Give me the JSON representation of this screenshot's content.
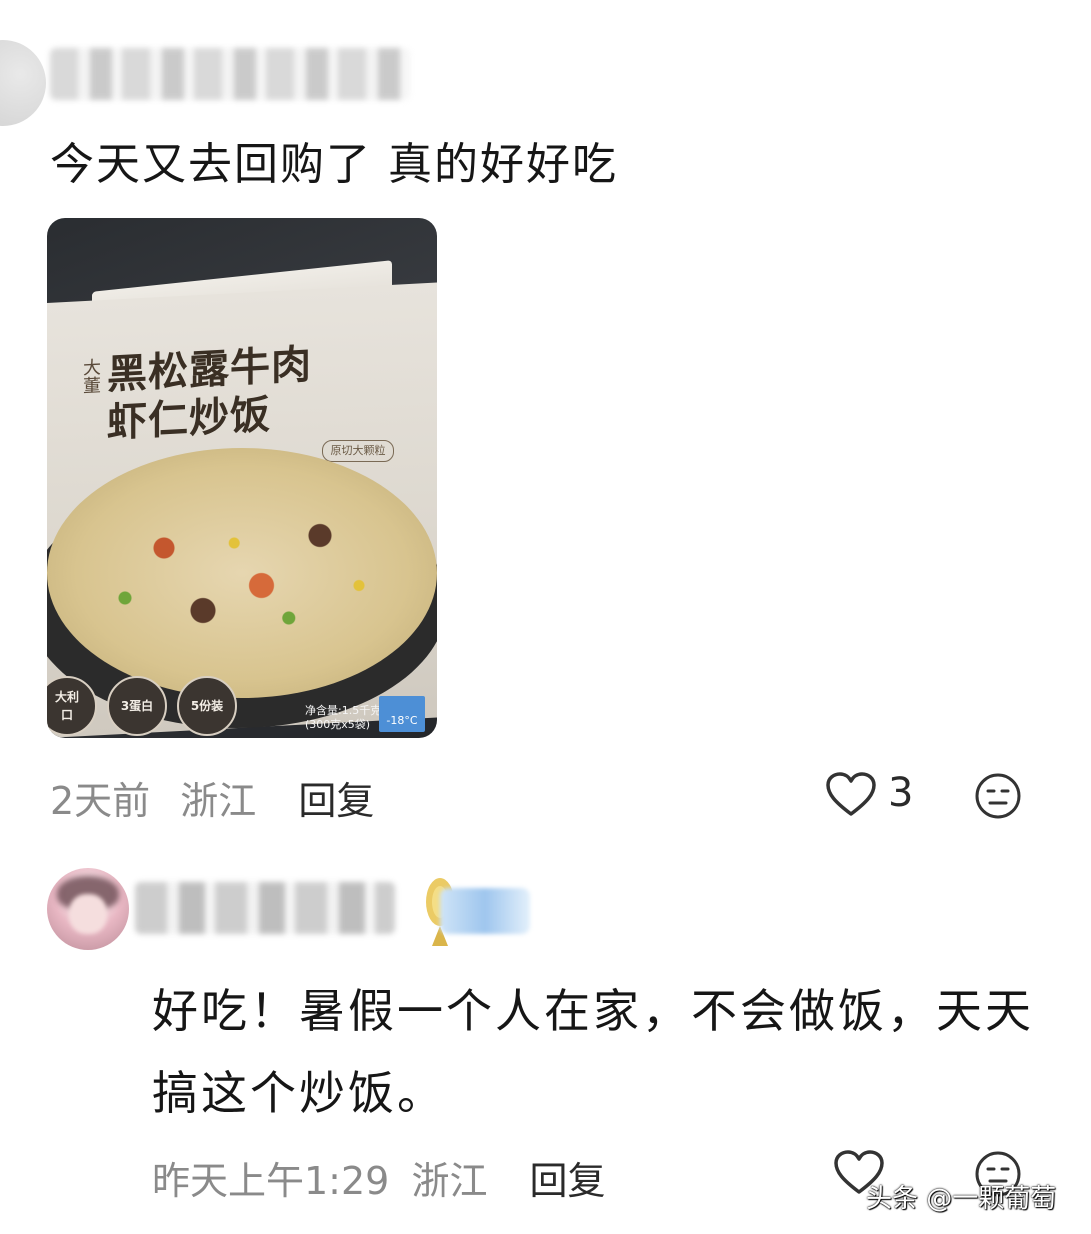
{
  "comment1": {
    "text": "今天又去回购了 真的好好吃",
    "photo": {
      "brand": "大董",
      "title_line1": "黑松露牛肉",
      "title_line2": "虾仁炒饭",
      "badge": "原切大颗粒",
      "icons": [
        {
          "line1": "大利",
          "line2": "口"
        },
        {
          "line1": "3蛋白",
          "line2": ""
        },
        {
          "line1": "5份装",
          "line2": ""
        }
      ],
      "net_weight_line1": "净含量:1.5千克",
      "net_weight_line2": "(300克x5袋)",
      "temperature": "-18°C"
    },
    "meta": {
      "time": "2天前",
      "location": "浙江",
      "reply": "回复"
    },
    "likes": "3",
    "icons": {
      "like": "heart-icon",
      "emoji": "emoji-icon"
    }
  },
  "comment2": {
    "text": "好吃！暑假一个人在家，不会做饭，天天搞这个炒饭。",
    "meta": {
      "time": "昨天上午1:29",
      "location": "浙江",
      "reply": "回复"
    },
    "icons": {
      "like": "heart-icon",
      "emoji": "emoji-icon",
      "medal": "medal-icon"
    }
  },
  "watermark": "头条 @一颗葡萄",
  "colors": {
    "meta_gray": "#8a8a8a",
    "text": "#161616",
    "level_tag": "#9fc6ee"
  }
}
